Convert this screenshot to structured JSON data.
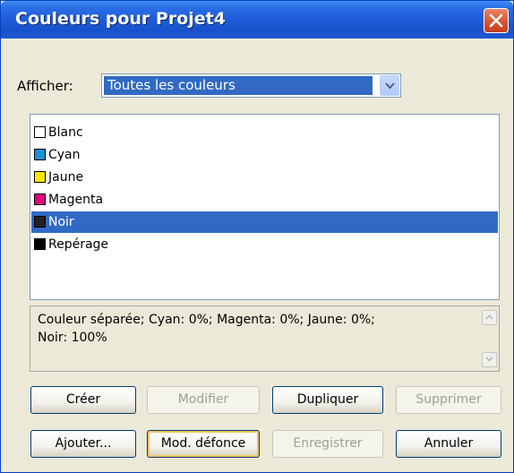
{
  "window": {
    "title": "Couleurs pour Projet4"
  },
  "afficher": {
    "label": "Afficher:",
    "value": "Toutes les couleurs"
  },
  "colors": [
    {
      "label": "Blanc",
      "swatch": "#ffffff"
    },
    {
      "label": "Cyan",
      "swatch": "#1e90d6"
    },
    {
      "label": "Jaune",
      "swatch": "#ffe600"
    },
    {
      "label": "Magenta",
      "swatch": "#e3007a"
    },
    {
      "label": "Noir",
      "swatch": "#222222",
      "selected": true
    },
    {
      "label": "Repérage",
      "swatch": "#000000"
    }
  ],
  "info": {
    "text": "Couleur séparée; Cyan: 0%; Magenta: 0%; Jaune: 0%;\nNoir: 100%"
  },
  "buttons": {
    "creer": "Créer",
    "modifier": "Modifier",
    "dupliquer": "Dupliquer",
    "supprimer": "Supprimer",
    "ajouter": "Ajouter...",
    "mod_defonce": "Mod. défonce",
    "enregistrer": "Enregistrer",
    "annuler": "Annuler"
  }
}
